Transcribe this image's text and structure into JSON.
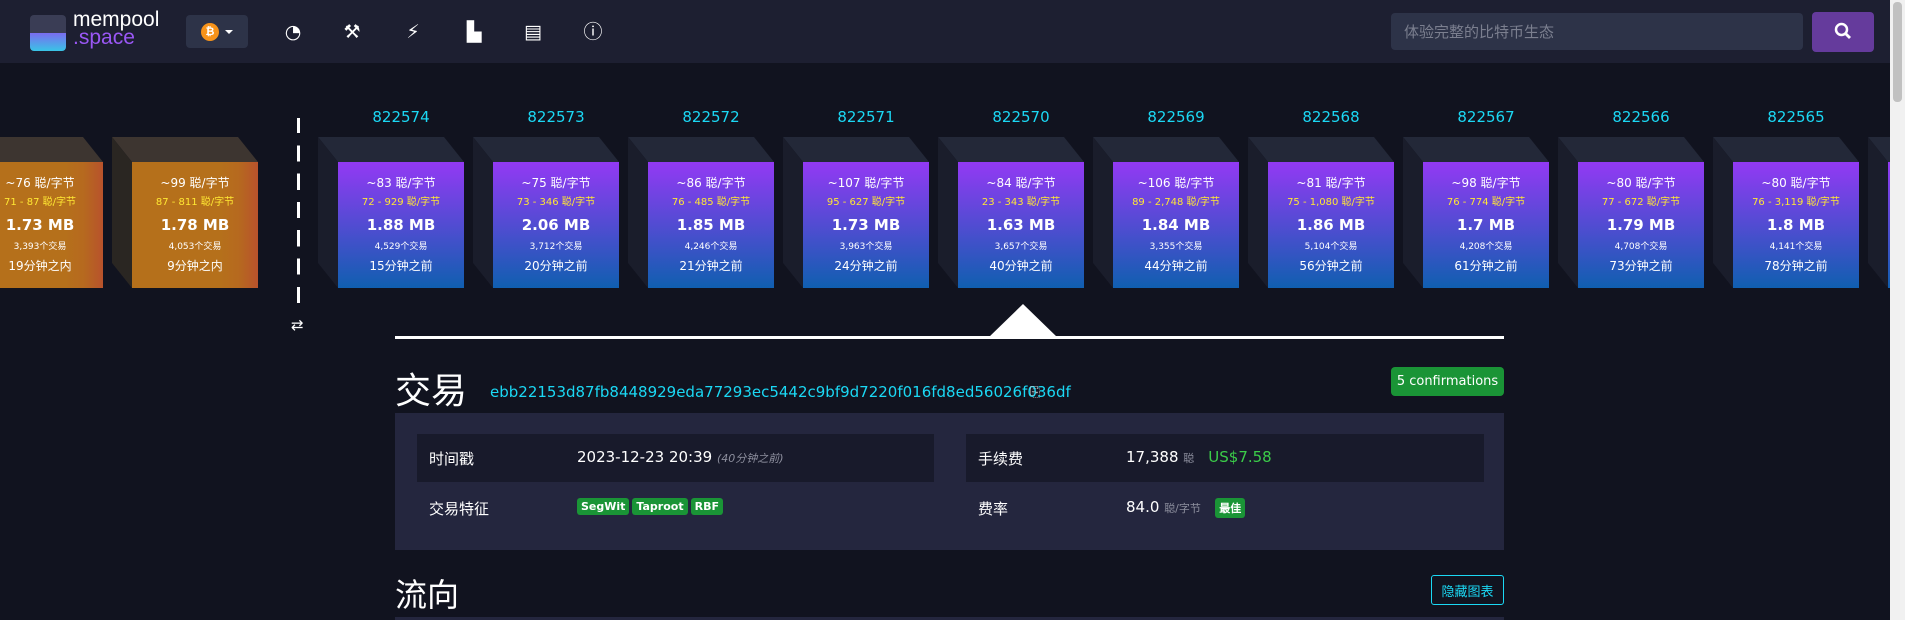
{
  "header": {
    "logo_main": "mempool",
    "logo_sub": ".space",
    "network": "bitcoin",
    "search_placeholder": "体验完整的比特币生态",
    "nav": [
      {
        "icon": "dashboard-icon",
        "glyph": "◔"
      },
      {
        "icon": "mining-hammer-icon",
        "glyph": "⚒"
      },
      {
        "icon": "lightning-icon",
        "glyph": "⚡"
      },
      {
        "icon": "graphs-icon",
        "glyph": "▙"
      },
      {
        "icon": "docs-book-icon",
        "glyph": "▤"
      },
      {
        "icon": "about-info-icon",
        "glyph": "ⓘ"
      }
    ]
  },
  "pending_blocks": [
    {
      "fee": "~76 聪/字节",
      "range": "71 - 87 聪/字节",
      "size": "1.73 MB",
      "txs": "3,393个交易",
      "time": "19分钟之内"
    },
    {
      "fee": "~99 聪/字节",
      "range": "87 - 811 聪/字节",
      "size": "1.78 MB",
      "txs": "4,053个交易",
      "time": "9分钟之内"
    }
  ],
  "blocks": [
    {
      "height": "822574",
      "fee": "~83 聪/字节",
      "range": "72 - 929 聪/字节",
      "size": "1.88 MB",
      "txs": "4,529个交易",
      "time": "15分钟之前"
    },
    {
      "height": "822573",
      "fee": "~75 聪/字节",
      "range": "73 - 346 聪/字节",
      "size": "2.06 MB",
      "txs": "3,712个交易",
      "time": "20分钟之前"
    },
    {
      "height": "822572",
      "fee": "~86 聪/字节",
      "range": "76 - 485 聪/字节",
      "size": "1.85 MB",
      "txs": "4,246个交易",
      "time": "21分钟之前"
    },
    {
      "height": "822571",
      "fee": "~107 聪/字节",
      "range": "95 - 627 聪/字节",
      "size": "1.73 MB",
      "txs": "3,963个交易",
      "time": "24分钟之前"
    },
    {
      "height": "822570",
      "fee": "~84 聪/字节",
      "range": "23 - 343 聪/字节",
      "size": "1.63 MB",
      "txs": "3,657个交易",
      "time": "40分钟之前"
    },
    {
      "height": "822569",
      "fee": "~106 聪/字节",
      "range": "89 - 2,748 聪/字节",
      "size": "1.84 MB",
      "txs": "3,355个交易",
      "time": "44分钟之前"
    },
    {
      "height": "822568",
      "fee": "~81 聪/字节",
      "range": "75 - 1,080 聪/字节",
      "size": "1.86 MB",
      "txs": "5,104个交易",
      "time": "56分钟之前"
    },
    {
      "height": "822567",
      "fee": "~98 聪/字节",
      "range": "76 - 774 聪/字节",
      "size": "1.7 MB",
      "txs": "4,208个交易",
      "time": "61分钟之前"
    },
    {
      "height": "822566",
      "fee": "~80 聪/字节",
      "range": "77 - 672 聪/字节",
      "size": "1.79 MB",
      "txs": "4,708个交易",
      "time": "73分钟之前"
    },
    {
      "height": "822565",
      "fee": "~80 聪/字节",
      "range": "76 - 3,119 聪/字节",
      "size": "1.8 MB",
      "txs": "4,141个交易",
      "time": "78分钟之前"
    }
  ],
  "tx": {
    "title": "交易",
    "txid": "ebb22153d87fb8448929eda77293ec5442c9bf9d7220f016fd8ed56026f036df",
    "confirmations": "5 confirmations",
    "timestamp_label": "时间戳",
    "timestamp": "2023-12-23 20:39",
    "timestamp_ago": "(40分钟之前)",
    "features_label": "交易特征",
    "features": [
      "SegWit",
      "Taproot",
      "RBF"
    ],
    "fee_label": "手续费",
    "fee": "17,388",
    "fee_unit": "聪",
    "fee_usd": "US$7.58",
    "feerate_label": "费率",
    "feerate": "84.0",
    "feerate_unit": "聪/字节",
    "feerate_badge": "最佳"
  },
  "flow": {
    "title": "流向",
    "hide_button": "隐藏图表"
  }
}
